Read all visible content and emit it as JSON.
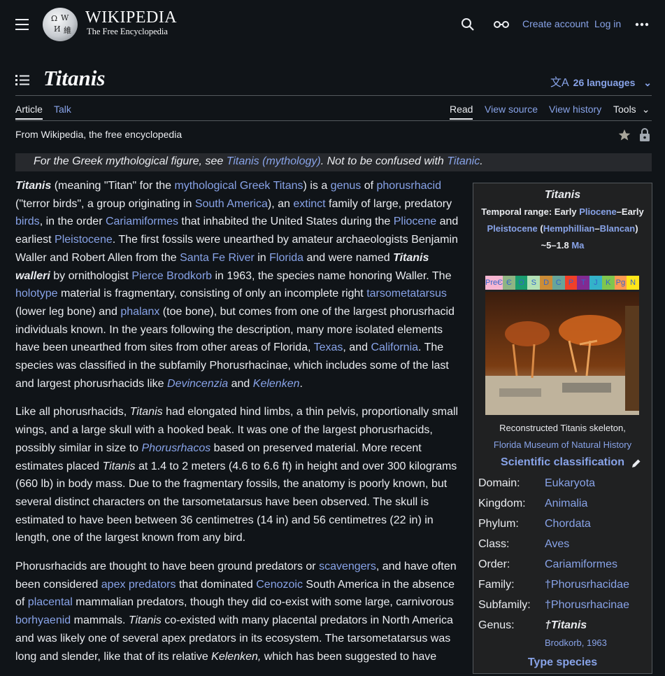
{
  "header": {
    "wordmark": "Wikipedia",
    "wordmark_display": "WIKIPEDIA",
    "tagline": "The Free Encyclopedia",
    "create_account": "Create account",
    "log_in": "Log in"
  },
  "page": {
    "title": "Titanis",
    "languages": "26 languages",
    "tabs": {
      "article": "Article",
      "talk": "Talk",
      "read": "Read",
      "view_source": "View source",
      "view_history": "View history",
      "tools": "Tools"
    },
    "from": "From Wikipedia, the free encyclopedia"
  },
  "hatnote": {
    "t1": "For the Greek mythological figure, see ",
    "l1": "Titanis (mythology)",
    "t2": ". Not to be confused with ",
    "l2": "Titanic",
    "t3": "."
  },
  "p1": {
    "b1": "Titanis",
    "t1": " (meaning \"Titan\" for the ",
    "l1": "mythological Greek Titans",
    "t2": ") is a ",
    "l2": "genus",
    "t3": " of ",
    "l3": "phorusrhacid",
    "t4": " (\"terror birds\", a group originating in ",
    "l4": "South America",
    "t5": "), an ",
    "l5": "extinct",
    "t6": " family of large, predatory ",
    "l6": "birds",
    "t7": ", in the order ",
    "l7": "Cariamiformes",
    "t8": " that inhabited the United States during the ",
    "l8": "Pliocene",
    "t9": " and earliest ",
    "l9": "Pleistocene",
    "t10": ". The first fossils were unearthed by amateur archaeologists Benjamin Waller and Robert Allen from the ",
    "l10": "Santa Fe River",
    "t11": " in ",
    "l11": "Florida",
    "t12": " and were named ",
    "b2": "Titanis walleri",
    "t13": " by ornithologist ",
    "l12": "Pierce Brodkorb",
    "t14": " in 1963, the species name honoring Waller. The ",
    "l13": "holotype",
    "t15": " material is fragmentary, consisting of only an incomplete right ",
    "l14": "tarsometatarsus",
    "t16": " (lower leg bone) and ",
    "l15": "phalanx",
    "t17": " (toe bone), but comes from one of the largest phorusrhacid individuals known. In the years following the description, many more isolated elements have been unearthed from sites from other areas of Florida, ",
    "l16": "Texas",
    "t18": ", and ",
    "l17": "California",
    "t19": ". The species was classified in the subfamily Phorusrhacinae, which includes some of the last and largest phorusrhacids like ",
    "l18": "Devincenzia",
    "t20": " and ",
    "l19": "Kelenken",
    "t21": "."
  },
  "p2": {
    "t1": "Like all phorusrhacids, ",
    "i1": "Titanis",
    "t2": " had elongated hind limbs, a thin pelvis, proportionally small wings, and a large skull with a hooked beak. It was one of the largest phorusrhacids, possibly similar in size to ",
    "l1": "Phorusrhacos",
    "t3": " based on preserved material. More recent estimates placed ",
    "i2": "Titanis",
    "t4": " at 1.4 to 2 meters (4.6 to 6.6 ft) in height and over 300 kilograms (660 lb) in body mass. Due to the fragmentary fossils, the anatomy is poorly known, but several distinct characters on the tarsometatarsus have been observed. The skull is estimated to have been between 36 centimetres (14 in) and 56 centimetres (22 in) in length, one of the largest known from any bird."
  },
  "p3": {
    "t1": "Phorusrhacids are thought to have been ground predators or ",
    "l1": "scavengers",
    "t2": ", and have often been considered ",
    "l2": "apex predators",
    "t3": " that dominated ",
    "l3": "Cenozoic",
    "t4": " South America in the absence of ",
    "l4": "placental",
    "t5": " mammalian predators, though they did co-exist with some large, carnivorous ",
    "l5": "borhyaenid",
    "t6": " mammals. ",
    "i1": "Titanis",
    "t7": " co-existed with many placental predators in North America and was likely one of several apex predators in its ecosystem. The tarsometatarsus was long and slender, like that of its relative ",
    "i2": "Kelenken,",
    "t8": " which has been suggested to have"
  },
  "infobox": {
    "title": "Titanis",
    "range": {
      "lbl": "Temporal range: Early ",
      "l1": "Pliocene",
      "t2": "–Early ",
      "l2": "Pleistocene",
      "t3": " (",
      "l3": "Hemphillian",
      "t4": "–",
      "l4": "Blancan",
      "t5": ")",
      "t6": "~5–1.8 ",
      "l5": "Ma"
    },
    "timescale": [
      "PreЄ",
      "Є",
      "O",
      "S",
      "D",
      "C",
      "P",
      "T",
      "J",
      "K",
      "Pg",
      "N"
    ],
    "caption": "Reconstructed Titanis skeleton,",
    "caption_link": "Florida Museum of Natural History",
    "sci_class": "Scientific classification",
    "rows": [
      {
        "k": "Domain:",
        "v": "Eukaryota"
      },
      {
        "k": "Kingdom:",
        "v": "Animalia"
      },
      {
        "k": "Phylum:",
        "v": "Chordata"
      },
      {
        "k": "Class:",
        "v": "Aves"
      },
      {
        "k": "Order:",
        "v": "Cariamiformes"
      },
      {
        "k": "Family:",
        "v": "†Phorusrhacidae"
      },
      {
        "k": "Subfamily:",
        "v": "†Phorusrhacinae"
      },
      {
        "k": "Genus:",
        "v": "†Titanis"
      }
    ],
    "authority": "Brodkorb",
    "authority_year": ", 1963",
    "type_species": "Type species"
  },
  "icons": [
    "menu-icon",
    "wikipedia-globe-logo",
    "search-icon",
    "glasses-icon",
    "more-icon",
    "toc-icon",
    "translate-icon",
    "chevron-down-icon",
    "star-icon",
    "lock-icon",
    "pencil-icon"
  ],
  "colors": {
    "background": "#101418",
    "text": "#eaecf0",
    "link": "#88a3e8",
    "infobox_bg": "#202122",
    "hatnote_bg": "#27292d"
  }
}
